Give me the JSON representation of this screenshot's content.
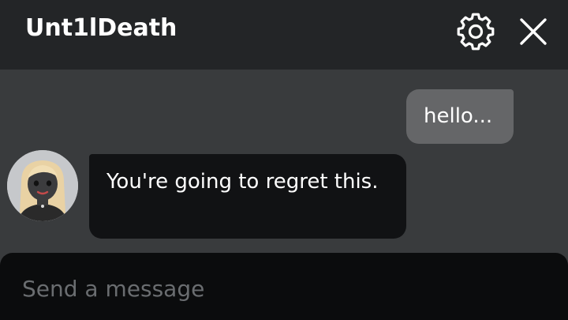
{
  "chat": {
    "title": "Unt1lDeath",
    "header_icons": {
      "settings": "gear-icon",
      "close": "close-icon"
    },
    "messages": [
      {
        "sender": "self",
        "text": "hello..."
      },
      {
        "sender": "other",
        "text": "You're going to regret this."
      }
    ],
    "composer": {
      "placeholder": "Send a message",
      "value": ""
    }
  },
  "colors": {
    "header_bg": "#232527",
    "body_bg": "#393b3d",
    "outgoing_bubble": "#656668",
    "incoming_bubble": "#111214",
    "composer_bg": "#0b0c0d",
    "text": "#ffffff",
    "placeholder": "#6a6d70"
  }
}
